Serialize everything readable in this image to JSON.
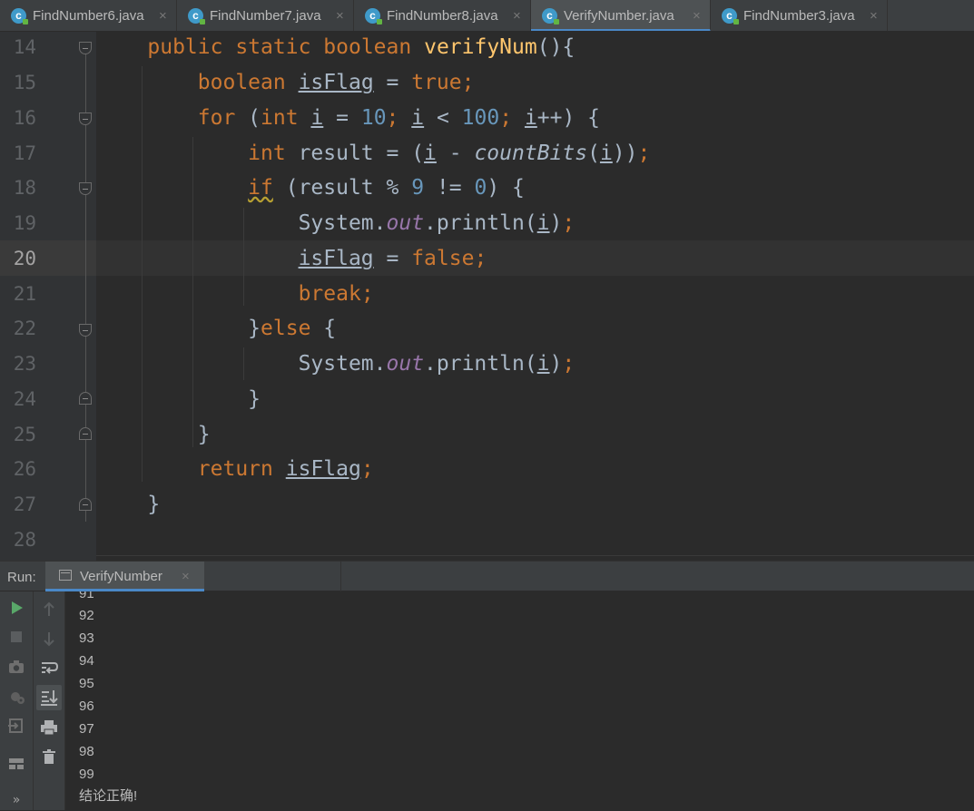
{
  "tabs": [
    {
      "label": "FindNumber6.java",
      "close": "×",
      "icon": "c"
    },
    {
      "label": "FindNumber7.java",
      "close": "×",
      "icon": "c"
    },
    {
      "label": "FindNumber8.java",
      "close": "×",
      "icon": "c"
    },
    {
      "label": "VerifyNumber.java",
      "close": "×",
      "icon": "c",
      "active": true
    },
    {
      "label": "FindNumber3.java",
      "close": "×",
      "icon": "c"
    }
  ],
  "editor": {
    "current_line": "20",
    "lines": [
      {
        "n": "14"
      },
      {
        "n": "15"
      },
      {
        "n": "16"
      },
      {
        "n": "17"
      },
      {
        "n": "18"
      },
      {
        "n": "19"
      },
      {
        "n": "20"
      },
      {
        "n": "21"
      },
      {
        "n": "22"
      },
      {
        "n": "23"
      },
      {
        "n": "24"
      },
      {
        "n": "25"
      },
      {
        "n": "26"
      },
      {
        "n": "27"
      },
      {
        "n": "28"
      }
    ],
    "tokens": {
      "l14": {
        "indent": "    ",
        "kw1": "public",
        "kw2": "static",
        "kw3": "boolean",
        "fn": "verifyNum",
        "rest": "(){"
      },
      "l15": {
        "indent": "        ",
        "kw": "boolean",
        "var": "isFlag",
        "op": " = ",
        "val": "true",
        "semi": ";"
      },
      "l16": {
        "indent": "        ",
        "kw": "for",
        "p1": " (",
        "kw2": "int",
        "sp": " ",
        "v1": "i",
        "p2": " = ",
        "n1": "10",
        "semi1": ";",
        "sp2": " ",
        "v2": "i",
        "p3": " < ",
        "n2": "100",
        "semi2": ";",
        "sp3": " ",
        "v3": "i",
        "p4": "++) {"
      },
      "l17": {
        "indent": "            ",
        "kw": "int",
        "p1": " result = (",
        "v1": "i",
        "p2": " - ",
        "fn": "countBits",
        "p3": "(",
        "v2": "i",
        "p4": "))",
        "semi": ";"
      },
      "l18": {
        "indent": "            ",
        "kw": "if",
        "p1": " (result % ",
        "n1": "9",
        "p2": " != ",
        "n2": "0",
        "p3": ") {"
      },
      "l19": {
        "indent": "                ",
        "p1": "System.",
        "fld": "out",
        "p2": ".println(",
        "v": "i",
        "p3": ")",
        "semi": ";"
      },
      "l20": {
        "indent": "                ",
        "var": "isFlag",
        "op": " = ",
        "val": "false",
        "semi": ";"
      },
      "l21": {
        "indent": "                ",
        "kw": "break",
        "semi": ";"
      },
      "l22": {
        "indent": "            ",
        "p1": "}",
        "kw": "else",
        "p2": " {"
      },
      "l23": {
        "indent": "                ",
        "p1": "System.",
        "fld": "out",
        "p2": ".println(",
        "v": "i",
        "p3": ")",
        "semi": ";"
      },
      "l24": {
        "indent": "            ",
        "p1": "}"
      },
      "l25": {
        "indent": "        ",
        "p1": "}"
      },
      "l26": {
        "indent": "        ",
        "kw": "return",
        "sp": " ",
        "var": "isFlag",
        "semi": ";"
      },
      "l27": {
        "indent": "    ",
        "p1": "}"
      }
    }
  },
  "run": {
    "label": "Run:",
    "tab_label": "VerifyNumber",
    "tab_close": "×",
    "output": [
      "91",
      "92",
      "93",
      "94",
      "95",
      "96",
      "97",
      "98",
      "99",
      "结论正确!"
    ]
  },
  "icons": {
    "run": "run-icon",
    "stop": "stop-icon",
    "camera": "camera-icon",
    "debug": "debug-icon",
    "login": "exit-icon",
    "layout": "layout-icon",
    "expand": "expand-icon",
    "up": "arrow-up-icon",
    "down": "arrow-down-icon",
    "wrap": "soft-wrap-icon",
    "scroll": "scroll-to-end-icon",
    "print": "print-icon",
    "trash": "trash-icon"
  },
  "colors": {
    "background": "#2b2b2b",
    "keyword": "#cc7832",
    "function": "#ffc66d",
    "number": "#6897bb",
    "field": "#9876aa",
    "text": "#a9b7c6",
    "accent": "#4a88c7",
    "run_green": "#59a869"
  }
}
